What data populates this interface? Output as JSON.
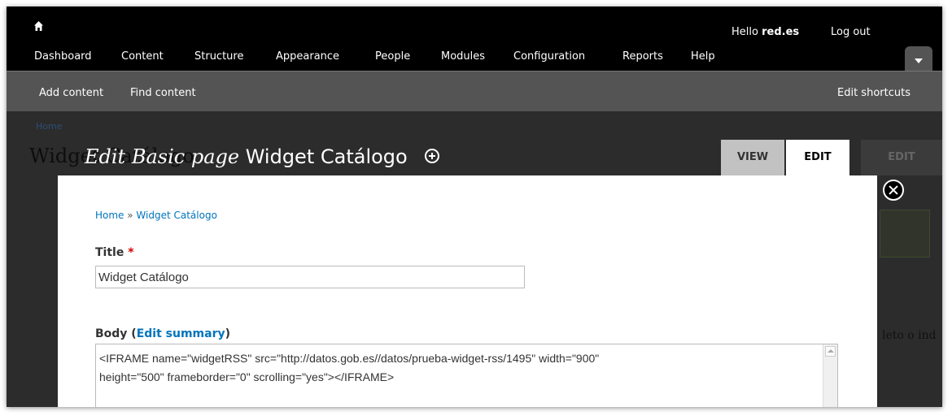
{
  "toolbar": {
    "menu": [
      "Dashboard",
      "Content",
      "Structure",
      "Appearance",
      "People",
      "Modules",
      "Configuration",
      "Reports",
      "Help"
    ],
    "greeting_prefix": "Hello ",
    "user": "red.es",
    "logout": "Log out"
  },
  "shortcuts": {
    "add_content": "Add content",
    "find_content": "Find content",
    "edit_shortcuts": "Edit shortcuts"
  },
  "background_page": {
    "breadcrumb": "Home",
    "title": "Widget Catálogo",
    "text_fragment": "leto o ind",
    "tab_edit": "EDIT"
  },
  "overlay": {
    "title_prefix": "Edit Basic page",
    "title_name": "Widget Catálogo",
    "tabs": {
      "view": "VIEW",
      "edit": "EDIT"
    }
  },
  "form": {
    "breadcrumb": {
      "home": "Home",
      "sep": " » ",
      "current": "Widget Catálogo"
    },
    "title_label": "Title",
    "required_mark": "*",
    "title_value": "Widget Catálogo",
    "body_label": "Body",
    "body_open": " (",
    "edit_summary": "Edit summary",
    "body_close": ")",
    "body_line1": "<IFRAME name=\"widgetRSS\" src=\"http://datos.gob.es//datos/prueba-widget-rss/1495\" width=\"900\"",
    "body_line2": "height=\"500\" frameborder=\"0\" scrolling=\"yes\"></IFRAME>"
  },
  "colors": {
    "link": "#0074bd",
    "toolbar": "#000000",
    "shortcut_bar": "#545454",
    "required": "#d40000"
  }
}
